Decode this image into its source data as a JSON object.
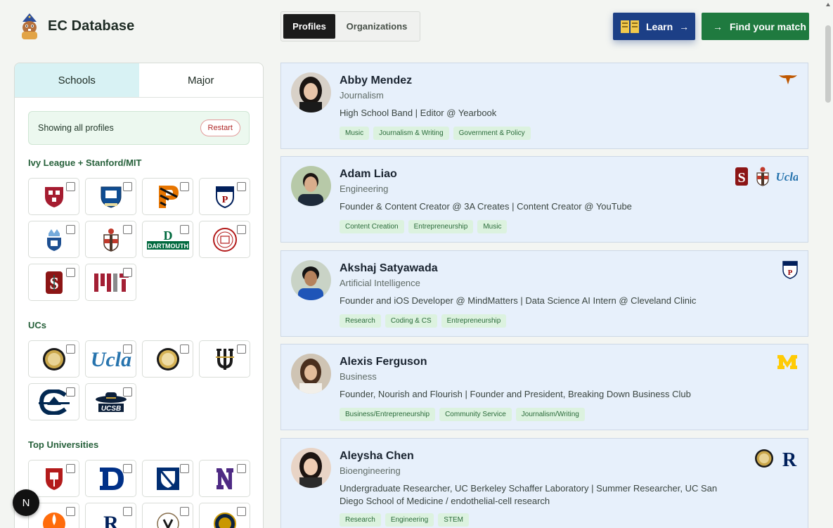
{
  "app": {
    "title": "EC Database"
  },
  "header": {
    "tabs": [
      {
        "label": "Profiles",
        "active": true
      },
      {
        "label": "Organizations",
        "active": false
      }
    ],
    "learn_label": "Learn",
    "learn_arrow": "→",
    "find_label": "Find your match",
    "find_arrow": "→"
  },
  "sidebar": {
    "tabs": [
      {
        "label": "Schools",
        "active": true
      },
      {
        "label": "Major",
        "active": false
      }
    ],
    "notice": "Showing all profiles",
    "restart_label": "Restart",
    "sections": [
      {
        "title": "Ivy League + Stanford/MIT",
        "schools": [
          "harvard",
          "yale",
          "princeton",
          "penn",
          "columbia",
          "brown",
          "dartmouth",
          "cornell",
          "stanford",
          "mit"
        ]
      },
      {
        "title": "UCs",
        "schools": [
          "uc-berkeley",
          "ucla",
          "uc-seal",
          "uc-irvine",
          "uc-davis",
          "ucsb"
        ]
      },
      {
        "title": "Top Universities",
        "schools": [
          "cornell-shield",
          "duke",
          "johns-hopkins",
          "northwestern",
          "caltech",
          "rice",
          "vanderbilt",
          "notre-dame"
        ]
      }
    ],
    "logo_text": {
      "dartmouth": "DARTMOUTH",
      "ucla": "Ucla",
      "ucsb": "UCSB",
      "penn": "PENN"
    }
  },
  "profiles": [
    {
      "name": "Abby Mendez",
      "major": "Journalism",
      "description": "High School Band | Editor @ Yearbook",
      "tags": [
        "Music",
        "Journalism & Writing",
        "Government & Policy"
      ],
      "schools": [
        "texas-longhorn-icon"
      ]
    },
    {
      "name": "Adam Liao",
      "major": "Engineering",
      "description": "Founder & Content Creator @ 3A Creates | Content Creator @ YouTube",
      "tags": [
        "Content Creation",
        "Entrepreneurship",
        "Music"
      ],
      "schools": [
        "stanford-icon",
        "brown-icon",
        "ucla-icon"
      ]
    },
    {
      "name": "Akshaj Satyawada",
      "major": "Artificial Intelligence",
      "description": "Founder and iOS Developer @ MindMatters | Data Science AI Intern @ Cleveland Clinic",
      "tags": [
        "Research",
        "Coding & CS",
        "Entrepreneurship"
      ],
      "schools": [
        "penn-icon"
      ]
    },
    {
      "name": "Alexis Ferguson",
      "major": "Business",
      "description": "Founder, Nourish and Flourish | Founder and President, Breaking Down Business Club",
      "tags": [
        "Business/Entrepreneurship",
        "Community Service",
        "Journalism/Writing"
      ],
      "schools": [
        "michigan-icon"
      ]
    },
    {
      "name": "Aleysha Chen",
      "major": "Bioengineering",
      "description": "Undergraduate Researcher, UC Berkeley Schaffer Laboratory | Summer Researcher, UC San Diego School of Medicine / endothelial-cell research",
      "tags": [
        "Research",
        "Engineering",
        "STEM"
      ],
      "schools": [
        "uc-berkeley-icon",
        "rice-icon"
      ]
    }
  ],
  "floating_badge": "N",
  "colors": {
    "accent_green": "#1f7a3f",
    "learn_blue": "#1c3f86",
    "card_bg": "#e7f0fb",
    "tag_bg": "#dcf2df"
  }
}
